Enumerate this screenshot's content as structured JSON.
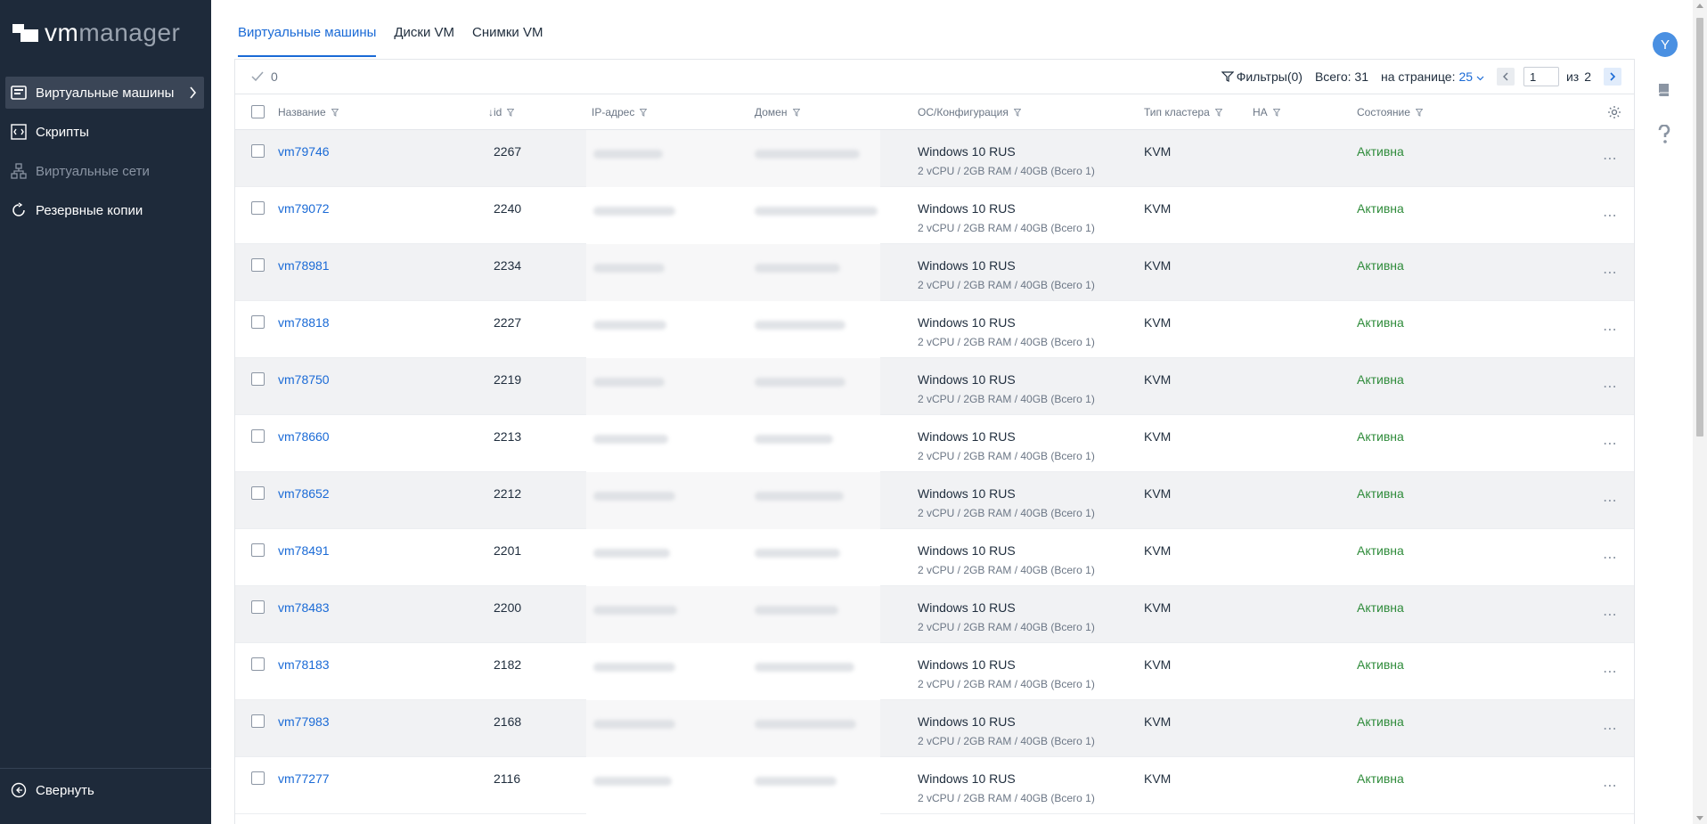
{
  "logo": {
    "part1": "vm",
    "part2": "manager"
  },
  "sidebar": {
    "items": [
      {
        "label": "Виртуальные машины",
        "icon": "vm-icon",
        "active": true
      },
      {
        "label": "Скрипты",
        "icon": "script-icon"
      },
      {
        "label": "Виртуальные сети",
        "icon": "network-icon",
        "disabled": true
      },
      {
        "label": "Резервные копии",
        "icon": "backup-icon"
      }
    ],
    "collapse_label": "Свернуть"
  },
  "tabs": [
    {
      "label": "Виртуальные машины",
      "active": true
    },
    {
      "label": "Диски VM"
    },
    {
      "label": "Снимки VM"
    }
  ],
  "toolbar": {
    "selected_count": "0",
    "filters_label": "Фильтры(0)",
    "total_label": "Всего: 31",
    "per_page_label": "на странице:",
    "per_page_value": "25",
    "page_value": "1",
    "of_label": "из",
    "page_total": "2"
  },
  "columns": {
    "name": "Название",
    "id": "id",
    "ip": "IP-адрес",
    "domain": "Домен",
    "os": "ОС/Конфигурация",
    "cluster": "Тип кластера",
    "ha": "HA",
    "state": "Состояние"
  },
  "rows": [
    {
      "name": "vm79746",
      "id": "2267",
      "os": "Windows 10 RUS",
      "config": "2 vCPU / 2GB RAM / 40GB (Всего 1)",
      "cluster": "KVM",
      "state": "Активна"
    },
    {
      "name": "vm79072",
      "id": "2240",
      "os": "Windows 10 RUS",
      "config": "2 vCPU / 2GB RAM / 40GB (Всего 1)",
      "cluster": "KVM",
      "state": "Активна"
    },
    {
      "name": "vm78981",
      "id": "2234",
      "os": "Windows 10 RUS",
      "config": "2 vCPU / 2GB RAM / 40GB (Всего 1)",
      "cluster": "KVM",
      "state": "Активна"
    },
    {
      "name": "vm78818",
      "id": "2227",
      "os": "Windows 10 RUS",
      "config": "2 vCPU / 2GB RAM / 40GB (Всего 1)",
      "cluster": "KVM",
      "state": "Активна"
    },
    {
      "name": "vm78750",
      "id": "2219",
      "os": "Windows 10 RUS",
      "config": "2 vCPU / 2GB RAM / 40GB (Всего 1)",
      "cluster": "KVM",
      "state": "Активна"
    },
    {
      "name": "vm78660",
      "id": "2213",
      "os": "Windows 10 RUS",
      "config": "2 vCPU / 2GB RAM / 40GB (Всего 1)",
      "cluster": "KVM",
      "state": "Активна"
    },
    {
      "name": "vm78652",
      "id": "2212",
      "os": "Windows 10 RUS",
      "config": "2 vCPU / 2GB RAM / 40GB (Всего 1)",
      "cluster": "KVM",
      "state": "Активна"
    },
    {
      "name": "vm78491",
      "id": "2201",
      "os": "Windows 10 RUS",
      "config": "2 vCPU / 2GB RAM / 40GB (Всего 1)",
      "cluster": "KVM",
      "state": "Активна"
    },
    {
      "name": "vm78483",
      "id": "2200",
      "os": "Windows 10 RUS",
      "config": "2 vCPU / 2GB RAM / 40GB (Всего 1)",
      "cluster": "KVM",
      "state": "Активна"
    },
    {
      "name": "vm78183",
      "id": "2182",
      "os": "Windows 10 RUS",
      "config": "2 vCPU / 2GB RAM / 40GB (Всего 1)",
      "cluster": "KVM",
      "state": "Активна"
    },
    {
      "name": "vm77983",
      "id": "2168",
      "os": "Windows 10 RUS",
      "config": "2 vCPU / 2GB RAM / 40GB (Всего 1)",
      "cluster": "KVM",
      "state": "Активна"
    },
    {
      "name": "vm77277",
      "id": "2116",
      "os": "Windows 10 RUS",
      "config": "2 vCPU / 2GB RAM / 40GB (Всего 1)",
      "cluster": "KVM",
      "state": "Активна"
    }
  ],
  "rail": {
    "avatar_letter": "Y"
  },
  "colors": {
    "accent": "#1a6ad6",
    "sidebar": "#1e2a3a",
    "status_active": "#2e8b3a"
  }
}
